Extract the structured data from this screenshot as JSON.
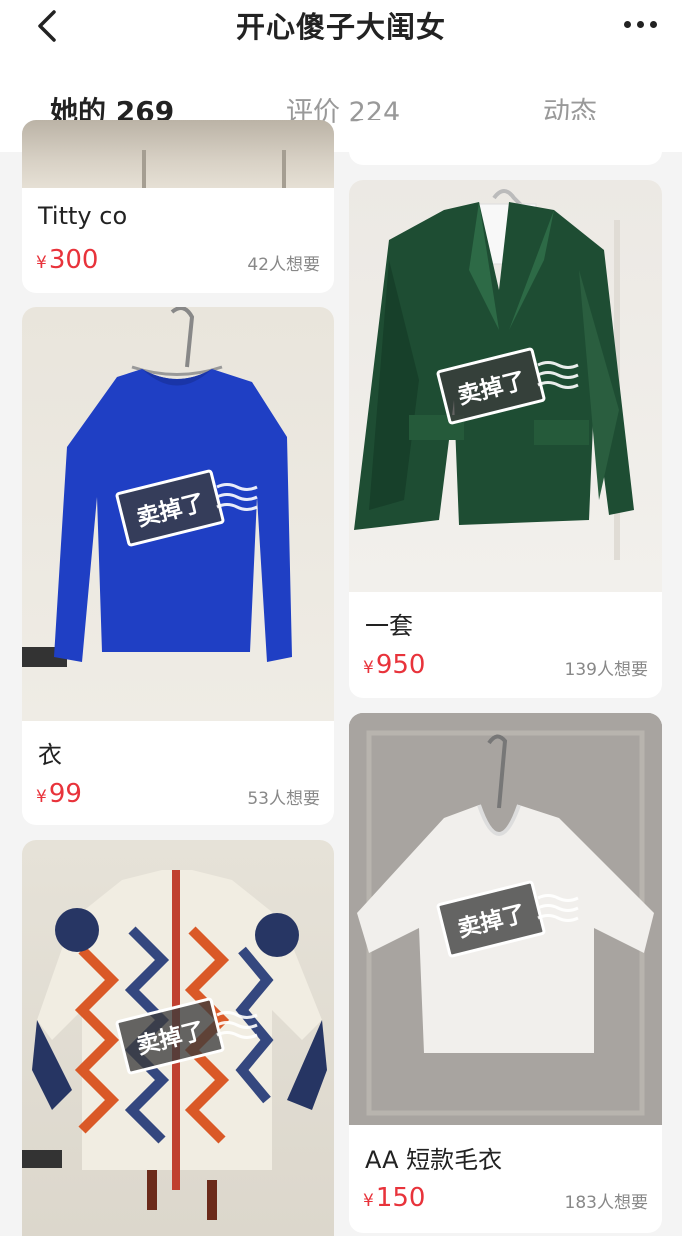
{
  "header": {
    "title": "开心傻子大闺女"
  },
  "tabs": [
    {
      "label": "她的 269"
    },
    {
      "label": "评价 224"
    },
    {
      "label": "动态"
    }
  ],
  "sold_label": "卖掉了",
  "items": [
    {
      "title": "Titty co",
      "currency": "¥",
      "price": "300",
      "wants": "42人想要"
    },
    {
      "title": "一套",
      "currency": "¥",
      "price": "950",
      "wants": "139人想要"
    },
    {
      "title": "衣",
      "currency": "¥",
      "price": "99",
      "wants": "53人想要"
    },
    {
      "title": "AA 短款毛衣",
      "currency": "¥",
      "price": "150",
      "wants": "183人想要"
    }
  ],
  "colors": {
    "accent": "#ffd200",
    "price": "#e8333b"
  },
  "icons": [
    "back-arrow-icon",
    "more-dots-icon"
  ]
}
